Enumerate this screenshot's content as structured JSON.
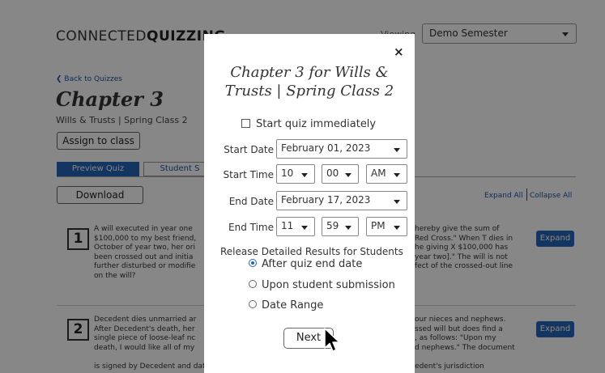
{
  "app": {
    "brand_light": "CONNECTED",
    "brand_bold": "QUIZZING"
  },
  "header": {
    "viewing_label": "Viewing",
    "semester": "Demo Semester"
  },
  "page": {
    "back_link": "Back to Quizzes",
    "title": "Chapter 3",
    "subtitle": "Wills & Trusts | Spring Class 2",
    "assign_button": "Assign to class",
    "tabs": [
      {
        "label": "Preview Quiz"
      },
      {
        "label": "Student S"
      }
    ],
    "download_button": "Download",
    "expand_all": "Expand All",
    "collapse_all": "Collapse All"
  },
  "questions": [
    {
      "number": "1",
      "left_lines": [
        "A will executed in year one",
        "$100,000 to my best friend,",
        "October of year two, her ori",
        "been crossed out and initia",
        "further disturbed or modifie",
        "on the will?"
      ],
      "right_lines": [
        "hereby give the sum of",
        "Red Cross.\" When T dies in",
        "he giving X $100,000 has",
        "year two].\" The will is not",
        "fect of the crossed-out line"
      ],
      "expand_label": "Expand"
    },
    {
      "number": "2",
      "left_lines": [
        "Decedent dies unmarried ar",
        "After Decedent's death, her",
        "single piece of loose-leaf nc",
        "death, I would like all of my"
      ],
      "right_lines": [
        "our nieces and nephews.",
        "ssed will but does find a",
        ", as follows: \"Upon my",
        "d nephews.\" The document"
      ],
      "last_line": "is signed by Decedent and dated approximately one year before Decedent's death. Decedent's jurisdiction",
      "expand_label": "Expand"
    }
  ],
  "modal": {
    "close_symbol": "×",
    "title": "Chapter 3 for Wills & Trusts | Spring Class 2",
    "start_immediately_label": "Start quiz immediately",
    "start_date_label": "Start Date",
    "start_date": "February 01, 2023",
    "start_time_label": "Start Time",
    "start_hour": "10",
    "start_minute": "00",
    "start_ampm": "AM",
    "end_date_label": "End Date",
    "end_date": "February 17, 2023",
    "end_time_label": "End Time",
    "end_hour": "11",
    "end_minute": "59",
    "end_ampm": "PM",
    "release_label": "Release Detailed Results for Students",
    "release_options": [
      {
        "label": "After quiz end date",
        "selected": true
      },
      {
        "label": "Upon student submission",
        "selected": false
      },
      {
        "label": "Date Range",
        "selected": false
      }
    ],
    "next_button": "Next"
  },
  "colors": {
    "accent": "#2366b8",
    "overlay": "rgba(0,0,0,0.47)"
  },
  "icons": [
    "close-icon",
    "chevron-left-icon",
    "caret-down-icon",
    "mouse-pointer-icon"
  ]
}
